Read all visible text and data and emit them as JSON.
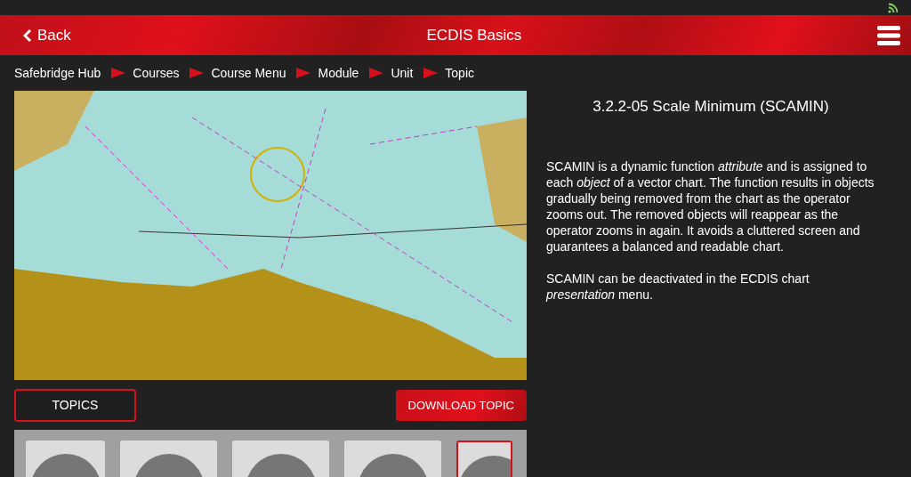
{
  "header": {
    "back_label": "Back",
    "title": "ECDIS Basics"
  },
  "breadcrumb": [
    "Safebridge Hub",
    "Courses",
    "Course Menu",
    "Module",
    "Unit",
    "Topic"
  ],
  "topic": {
    "title": "3.2.2-05 Scale Minimum (SCAMIN)",
    "paragraphs": [
      "SCAMIN is a dynamic function *attribute* and is assigned to each *object* of a vector chart. The function results in objects gradually being removed from the chart as the operator zooms out. The removed objects will reappear as the operator zooms in again. It avoids a cluttered screen and guarantees a balanced and readable chart.",
      "SCAMIN can be deactivated in the ECDIS chart *presentation* menu."
    ]
  },
  "buttons": {
    "topics": "TOPICS",
    "download": "DOWNLOAD TOPIC"
  },
  "thumbnails": [
    {
      "selected": false
    },
    {
      "selected": false
    },
    {
      "selected": false
    },
    {
      "selected": false
    },
    {
      "selected": true
    }
  ]
}
